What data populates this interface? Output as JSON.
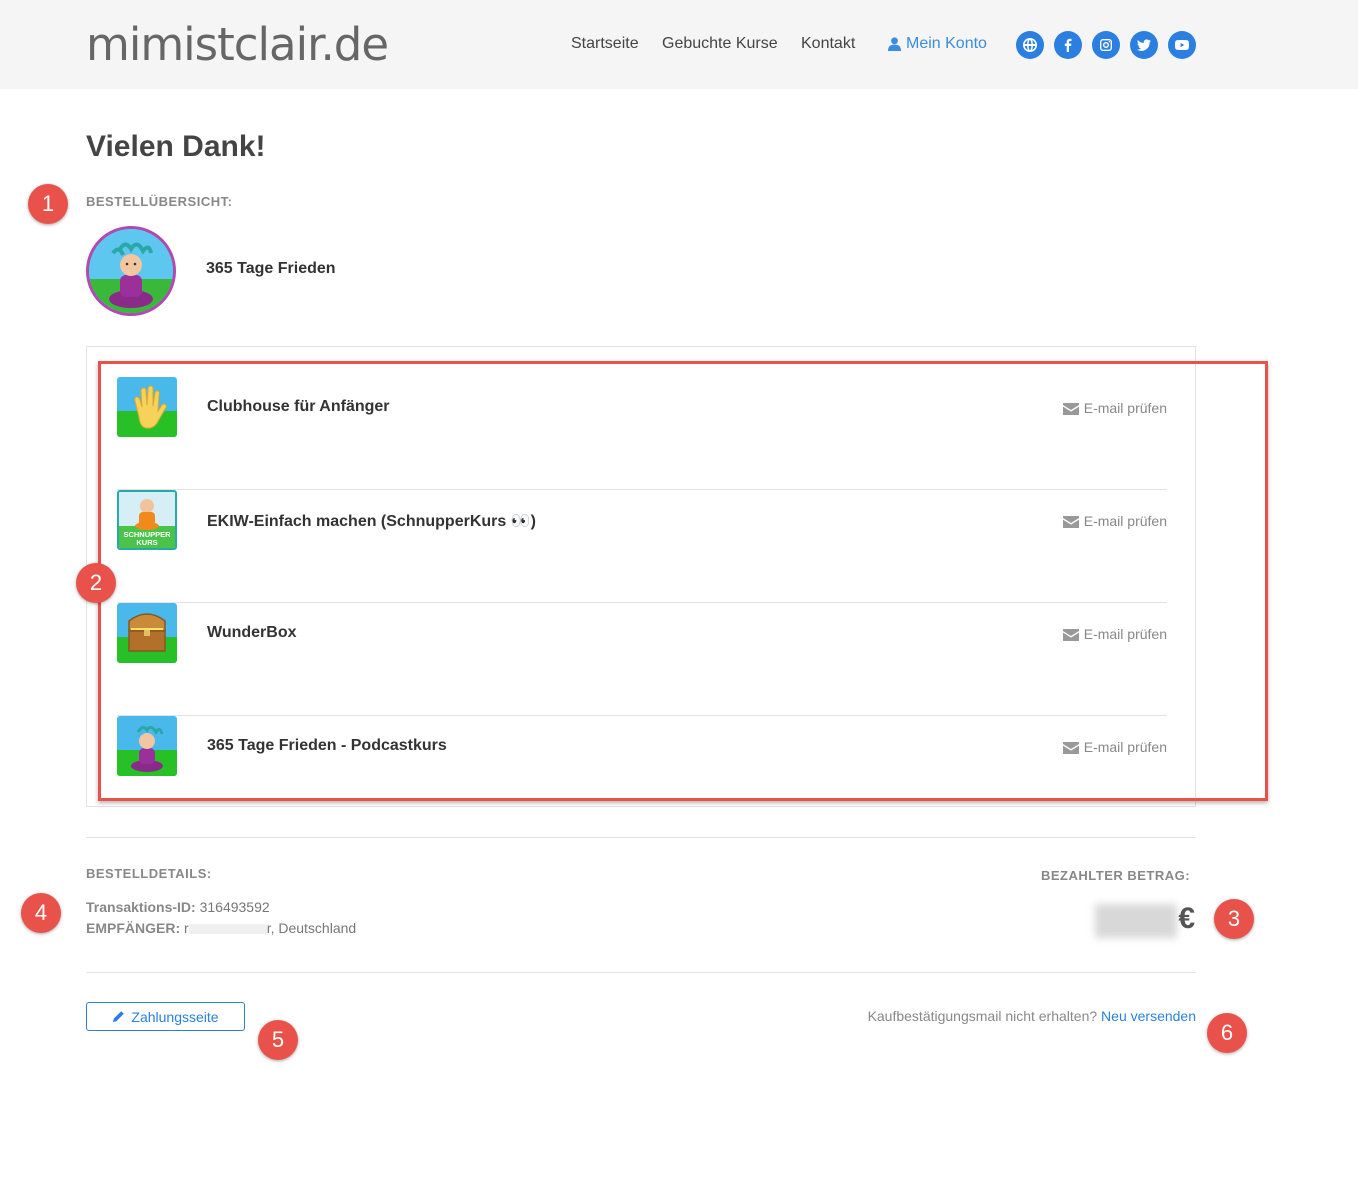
{
  "header": {
    "logo": "mimistclair.de",
    "nav": [
      "Startseite",
      "Gebuchte Kurse",
      "Kontakt"
    ],
    "account_label": "Mein Konto",
    "social": [
      "globe-icon",
      "facebook-icon",
      "instagram-icon",
      "twitter-icon",
      "youtube-icon"
    ]
  },
  "page": {
    "title": "Vielen Dank!",
    "order_overview_label": "BESTELLÜBERSICHT:",
    "main_course": "365 Tage Frieden"
  },
  "courses": [
    {
      "name": "Clubhouse für Anfänger",
      "status": "E-mail prüfen",
      "thumb": "waving-hand"
    },
    {
      "name": "EKIW-Einfach machen (SchnupperKurs 👀)",
      "status": "E-mail prüfen",
      "thumb": "schnupperkurs",
      "thumb_text": "SCHNUPPER KURS"
    },
    {
      "name": "WunderBox",
      "status": "E-mail prüfen",
      "thumb": "treasure-chest"
    },
    {
      "name": "365 Tage Frieden - Podcastkurs",
      "status": "E-mail prüfen",
      "thumb": "meditating-figure"
    }
  ],
  "details": {
    "label": "BESTELLDETAILS:",
    "transaction_label": "Transaktions-ID:",
    "transaction_id": "316493592",
    "recipient_label": "EMPFÄNGER:",
    "recipient_prefix": "r",
    "recipient_suffix": "r, Deutschland"
  },
  "payment": {
    "label": "BEZAHLTER BETRAG:",
    "currency": "€"
  },
  "footer": {
    "pay_button": "Zahlungsseite",
    "resend_text": "Kaufbestätigungsmail nicht erhalten?",
    "resend_link": "Neu versenden"
  },
  "annotations": [
    "1",
    "2",
    "3",
    "4",
    "5",
    "6"
  ],
  "colors": {
    "accent": "#2a7fe0",
    "annotation": "#e8524a",
    "topbar": "#f5f5f5"
  }
}
